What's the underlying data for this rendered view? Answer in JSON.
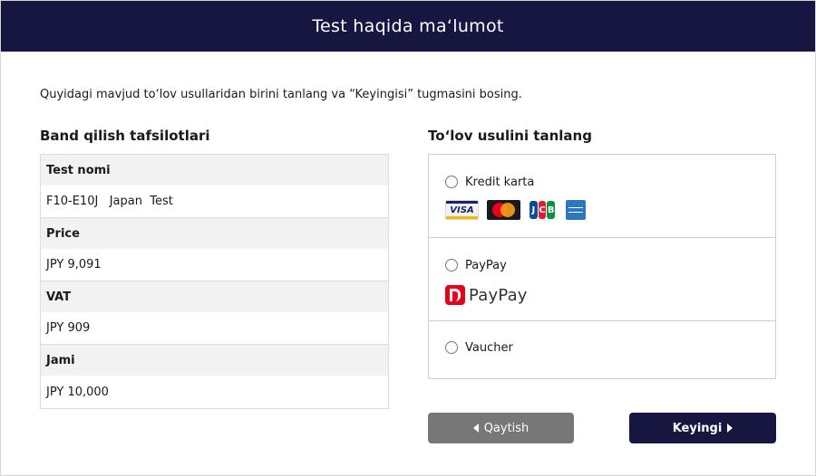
{
  "header": {
    "title": "Test haqida ma‘lumot"
  },
  "instruction": "Quyidagi mavjud to‘lov usullaridan birini tanlang va “Keyingisi” tugmasini bosing.",
  "details": {
    "title": "Band qilish tafsilotlari",
    "rows": [
      {
        "label": "Test nomi",
        "value": "F10-E10J   Japan  Test"
      },
      {
        "label": "Price",
        "value": "JPY 9,091"
      },
      {
        "label": "VAT",
        "value": "JPY 909"
      },
      {
        "label": "Jami",
        "value": "JPY 10,000"
      }
    ]
  },
  "payment": {
    "title": "To‘lov usulini tanlang",
    "methods": [
      {
        "label": "Kredit karta",
        "selected": false,
        "logos": [
          "visa",
          "mastercard",
          "jcb",
          "amex"
        ]
      },
      {
        "label": "PayPay",
        "selected": false,
        "logo_text": "PayPay"
      },
      {
        "label": "Vaucher",
        "selected": false
      }
    ],
    "card_logo_text": {
      "visa": "VISA",
      "jcb": "JCB"
    }
  },
  "buttons": {
    "back": "Qaytish",
    "next": "Keyingi"
  },
  "colors": {
    "primary": "#161640",
    "secondary_button": "#777777",
    "paypay_red": "#e3001b"
  }
}
